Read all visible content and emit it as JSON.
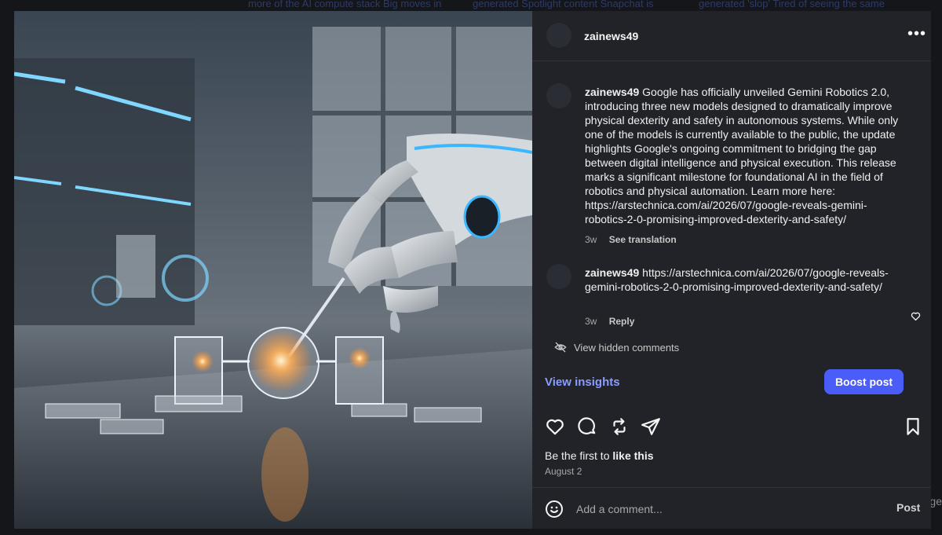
{
  "background": {
    "snippets": [
      "more of the AI compute stack Big moves in",
      "generated Spotlight content Snapchat is",
      "generated 'slop' Tired of seeing the same"
    ],
    "right_edge_text": "ge"
  },
  "post": {
    "username": "zainews49",
    "more_icon": "more-horizontal-icon"
  },
  "caption": {
    "username": "zainews49",
    "text": "Google has officially unveiled Gemini Robotics 2.0, introducing three new models designed to dramatically improve physical dexterity and safety in autonomous systems. While only one of the models is currently available to the public, the update highlights Google's ongoing commitment to bridging the gap between digital intelligence and physical execution. This release marks a significant milestone for foundational AI in the field of robotics and physical automation. Learn more here: https://arstechnica.com/ai/2026/07/google-reveals-gemini-robotics-2-0-promising-improved-dexterity-and-safety/",
    "time": "3w",
    "action": "See translation"
  },
  "comment": {
    "username": "zainews49",
    "text": "https://arstechnica.com/ai/2026/07/google-reveals-gemini-robotics-2-0-promising-improved-dexterity-and-safety/",
    "time": "3w",
    "action": "Reply"
  },
  "hidden": {
    "label": "View hidden comments"
  },
  "insights_label": "View insights",
  "boost_label": "Boost post",
  "likes": {
    "prefix": "Be the first to ",
    "emphasis": "like this"
  },
  "date": "August 2",
  "composer": {
    "placeholder": "Add a comment...",
    "post_label": "Post"
  },
  "colors": {
    "accent": "#4a5df9",
    "link": "#8a9cff",
    "panel": "#212328"
  }
}
